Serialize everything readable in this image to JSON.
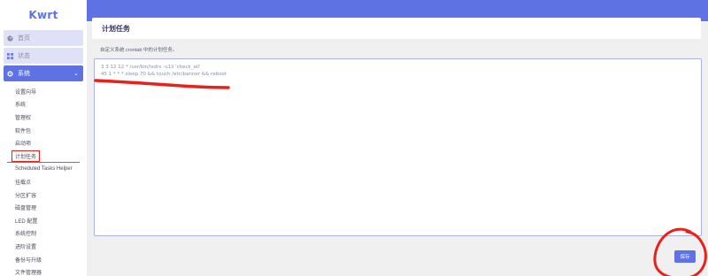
{
  "brand": {
    "name": "Kwrt"
  },
  "sidebar": {
    "items": [
      {
        "label": "首页",
        "icon": "dashboard-icon"
      },
      {
        "label": "状态",
        "icon": "status-icon"
      },
      {
        "label": "系统",
        "icon": "gear-icon",
        "expanded": true
      }
    ],
    "subitems": [
      "设置向导",
      "系统",
      "管理权",
      "软件包",
      "启动项",
      "计划任务",
      "Scheduled Tasks Helper",
      "挂载点",
      "分区扩容",
      "磁盘管理",
      "LED 配置",
      "系统控制",
      "进阶设置",
      "备份与升级",
      "文件管理器"
    ],
    "current_subitem": "计划任务"
  },
  "page": {
    "title": "计划任务",
    "description": "自定义系统 crontab 中的计划任务。"
  },
  "editor": {
    "lines": [
      "3 3 12 12 * /usr/bin/lsdrv -u1li 'check_all'",
      "45 1 * * * sleep 70 && touch /etc/banner && reboot"
    ]
  },
  "actions": {
    "save_label": "保存"
  },
  "colors": {
    "accent": "#5e72e4",
    "annotation": "#e8221b"
  }
}
